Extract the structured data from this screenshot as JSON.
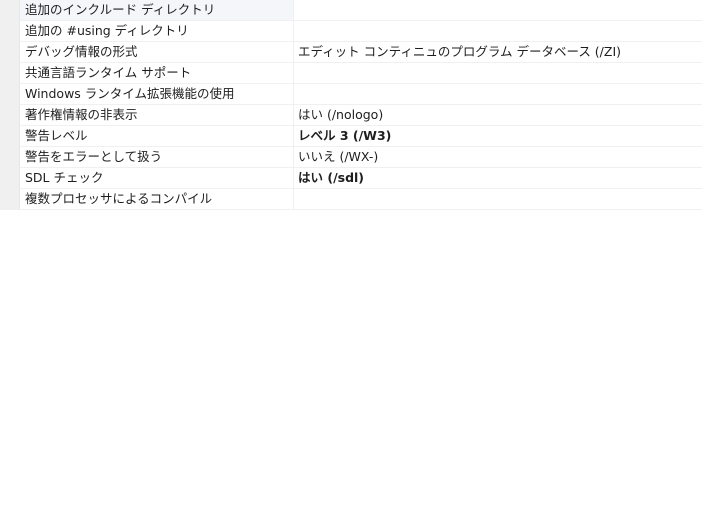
{
  "properties": [
    {
      "name": "追加のインクルード ディレクトリ",
      "value": "",
      "bold": false
    },
    {
      "name": "追加の #using ディレクトリ",
      "value": "",
      "bold": false
    },
    {
      "name": "デバッグ情報の形式",
      "value": "エディット コンティニュのプログラム データベース (/ZI)",
      "bold": false
    },
    {
      "name": "共通言語ランタイム サポート",
      "value": "",
      "bold": false
    },
    {
      "name": "Windows ランタイム拡張機能の使用",
      "value": "",
      "bold": false
    },
    {
      "name": "著作権情報の非表示",
      "value": "はい (/nologo)",
      "bold": false
    },
    {
      "name": "警告レベル",
      "value": "レベル 3 (/W3)",
      "bold": true
    },
    {
      "name": "警告をエラーとして扱う",
      "value": "いいえ (/WX-)",
      "bold": false
    },
    {
      "name": "SDL チェック",
      "value": "はい (/sdl)",
      "bold": true
    },
    {
      "name": "複数プロセッサによるコンパイル",
      "value": "",
      "bold": false
    }
  ]
}
